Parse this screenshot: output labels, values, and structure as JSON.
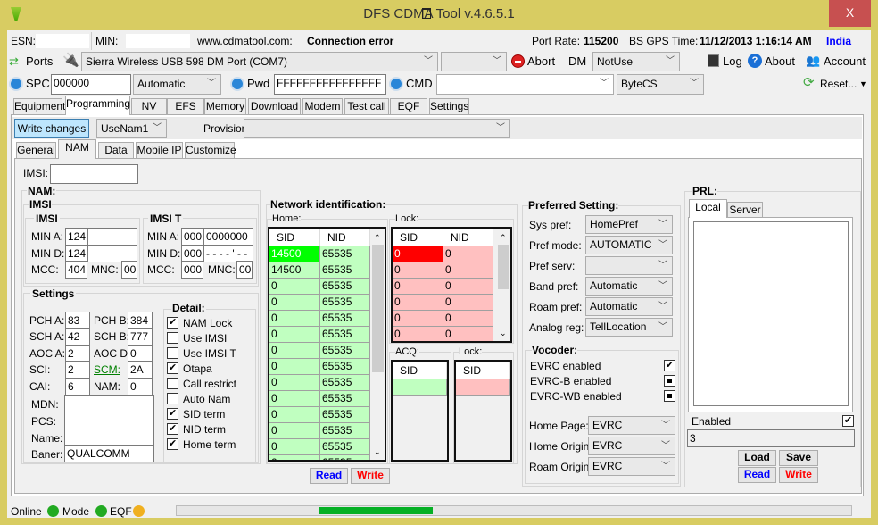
{
  "window": {
    "title": "DFS CDMA Tool v.4.6.5.1",
    "minimize": "_",
    "maximize": "□",
    "close": "X"
  },
  "info": {
    "esn_label": "ESN:",
    "esn_value": "",
    "min_label": "MIN:",
    "min_value": "",
    "site_label": "www.cdmatool.com:",
    "site_status": "Connection error",
    "port_rate_label": "Port Rate:",
    "port_rate": "115200",
    "gps_label": "BS GPS Time:",
    "gps_time": "11/12/2013 1:16:14 AM",
    "region_link": "India"
  },
  "toolbar": {
    "ports": "Ports",
    "port_select": "Sierra Wireless USB 598 DM Port (COM7)",
    "second_select": "",
    "abort": "Abort",
    "dm_label": "DM",
    "dm_select": "NotUse",
    "log": "Log",
    "about": "About",
    "account": "Account"
  },
  "toolbar2": {
    "spc_label": "SPC",
    "spc_value": "000000",
    "spc_mode": "Automatic",
    "pwd_label": "Pwd",
    "pwd_value": "FFFFFFFFFFFFFFFF",
    "cmd_label": "CMD",
    "cmd_value": "",
    "cmd_mode": "ByteCS",
    "reset": "Reset..."
  },
  "tabs": [
    "Equipment",
    "Programming",
    "NV",
    "EFS",
    "Memory",
    "Download",
    "Modem",
    "Test call",
    "EQF",
    "Settings"
  ],
  "active_tab": "Programming",
  "programming": {
    "write_changes": "Write changes",
    "nam_select": "UseNam1",
    "provisioning_label": "Provisioning",
    "provisioning_value": ""
  },
  "subtabs": [
    "General",
    "NAM",
    "Data",
    "Mobile IP",
    "Customize"
  ],
  "active_subtab": "NAM",
  "nam": {
    "imsi_label": "IMSI:",
    "imsi_value": "",
    "group_title": "NAM:",
    "imsi_group": "IMSI",
    "imsi": {
      "title": "IMSI",
      "min_a_label": "MIN A:",
      "min_a_1": "124",
      "min_a_2": "",
      "min_d_label": "MIN D:",
      "min_d_1": "124",
      "min_d_2": "",
      "mcc_label": "MCC:",
      "mcc": "404",
      "mnc_label": "MNC:",
      "mnc": "00"
    },
    "imsi_t": {
      "title": "IMSI T",
      "min_a_label": "MIN A:",
      "min_a_1": "000",
      "min_a_2": "0000000",
      "min_d_label": "MIN D:",
      "min_d_1": "000",
      "min_d_2": "- - - - ' - -",
      "mcc_label": "MCC:",
      "mcc": "000",
      "mnc_label": "MNC:",
      "mnc": "00"
    },
    "settings": {
      "title": "Settings",
      "pch_a_label": "PCH A:",
      "pch_a": "83",
      "pch_b_label": "PCH B:",
      "pch_b": "384",
      "sch_a_label": "SCH A:",
      "sch_a": "42",
      "sch_b_label": "SCH B:",
      "sch_b": "777",
      "aoc_a_label": "AOC A:",
      "aoc_a": "2",
      "aoc_d_label": "AOC D:",
      "aoc_d": "0",
      "sci_label": "SCI:",
      "sci": "2",
      "scm_label": "SCM:",
      "scm": "2A",
      "cai_label": "CAI:",
      "cai": "6",
      "nam_label": "NAM:",
      "nam": "0",
      "mdn_label": "MDN:",
      "mdn": "",
      "pcs_label": "PCS:",
      "pcs": "",
      "name_label": "Name:",
      "name": "",
      "baner_label": "Baner:",
      "baner": "QUALCOMM"
    },
    "detail": {
      "title": "Detail:",
      "items": [
        {
          "label": "NAM Lock",
          "checked": true
        },
        {
          "label": "Use IMSI",
          "checked": false
        },
        {
          "label": "Use IMSI T",
          "checked": false
        },
        {
          "label": "Otapa",
          "checked": true
        },
        {
          "label": "Call restrict",
          "checked": false
        },
        {
          "label": "Auto Nam",
          "checked": false
        },
        {
          "label": "SID term",
          "checked": true
        },
        {
          "label": "NID term",
          "checked": true
        },
        {
          "label": "Home term",
          "checked": true
        }
      ]
    }
  },
  "network": {
    "title": "Network identification:",
    "home_label": "Home:",
    "lock_label": "Lock:",
    "acq_label": "ACQ:",
    "lock2_label": "Lock:",
    "sid_header": "SID",
    "nid_header": "NID",
    "home_rows": [
      [
        "14500",
        "65535"
      ],
      [
        "14500",
        "65535"
      ],
      [
        "0",
        "65535"
      ],
      [
        "0",
        "65535"
      ],
      [
        "0",
        "65535"
      ],
      [
        "0",
        "65535"
      ],
      [
        "0",
        "65535"
      ],
      [
        "0",
        "65535"
      ],
      [
        "0",
        "65535"
      ],
      [
        "0",
        "65535"
      ],
      [
        "0",
        "65535"
      ],
      [
        "0",
        "65535"
      ],
      [
        "0",
        "65535"
      ],
      [
        "0",
        "65535"
      ]
    ],
    "lock_rows": [
      [
        "0",
        "0"
      ],
      [
        "0",
        "0"
      ],
      [
        "0",
        "0"
      ],
      [
        "0",
        "0"
      ],
      [
        "0",
        "0"
      ],
      [
        "0",
        "0"
      ]
    ],
    "read": "Read",
    "write": "Write"
  },
  "preferred": {
    "title": "Preferred Setting:",
    "rows": [
      {
        "label": "Sys pref:",
        "value": "HomePref"
      },
      {
        "label": "Pref mode:",
        "value": "AUTOMATIC"
      },
      {
        "label": "Pref serv:",
        "value": ""
      },
      {
        "label": "Band pref:",
        "value": "Automatic"
      },
      {
        "label": "Roam pref:",
        "value": "Automatic"
      },
      {
        "label": "Analog reg:",
        "value": "TellLocation"
      }
    ]
  },
  "vocoder": {
    "title": "Vocoder:",
    "items": [
      {
        "label": "EVRC enabled",
        "state": "checked"
      },
      {
        "label": "EVRC-B enabled",
        "state": "indeterminate"
      },
      {
        "label": "EVRC-WB enabled",
        "state": "indeterminate"
      }
    ],
    "rows": [
      {
        "label": "Home Page:",
        "value": "EVRC"
      },
      {
        "label": "Home Origin:",
        "value": "EVRC"
      },
      {
        "label": "Roam Origin:",
        "value": "EVRC"
      }
    ]
  },
  "prl": {
    "title": "PRL:",
    "tabs": [
      "Local",
      "Server"
    ],
    "active_tab": "Local",
    "enabled_label": "Enabled",
    "enabled": true,
    "value": "3",
    "load": "Load",
    "save": "Save",
    "read": "Read",
    "write": "Write"
  },
  "status": {
    "online": "Online",
    "mode": "Mode",
    "eqf": "EQF",
    "progress_segment_start_pct": 21,
    "progress_segment_end_pct": 38
  },
  "colors": {
    "frame": "#d8cc62",
    "close": "#c75050",
    "home_first": "#00ff00",
    "home_cell": "#c0ffc0",
    "lock_first": "#ff0000",
    "lock_cell": "#ffc0c0",
    "read": "#0000ff",
    "write": "#ff0000",
    "progress": "#06b025",
    "scm_link": "#008000"
  }
}
